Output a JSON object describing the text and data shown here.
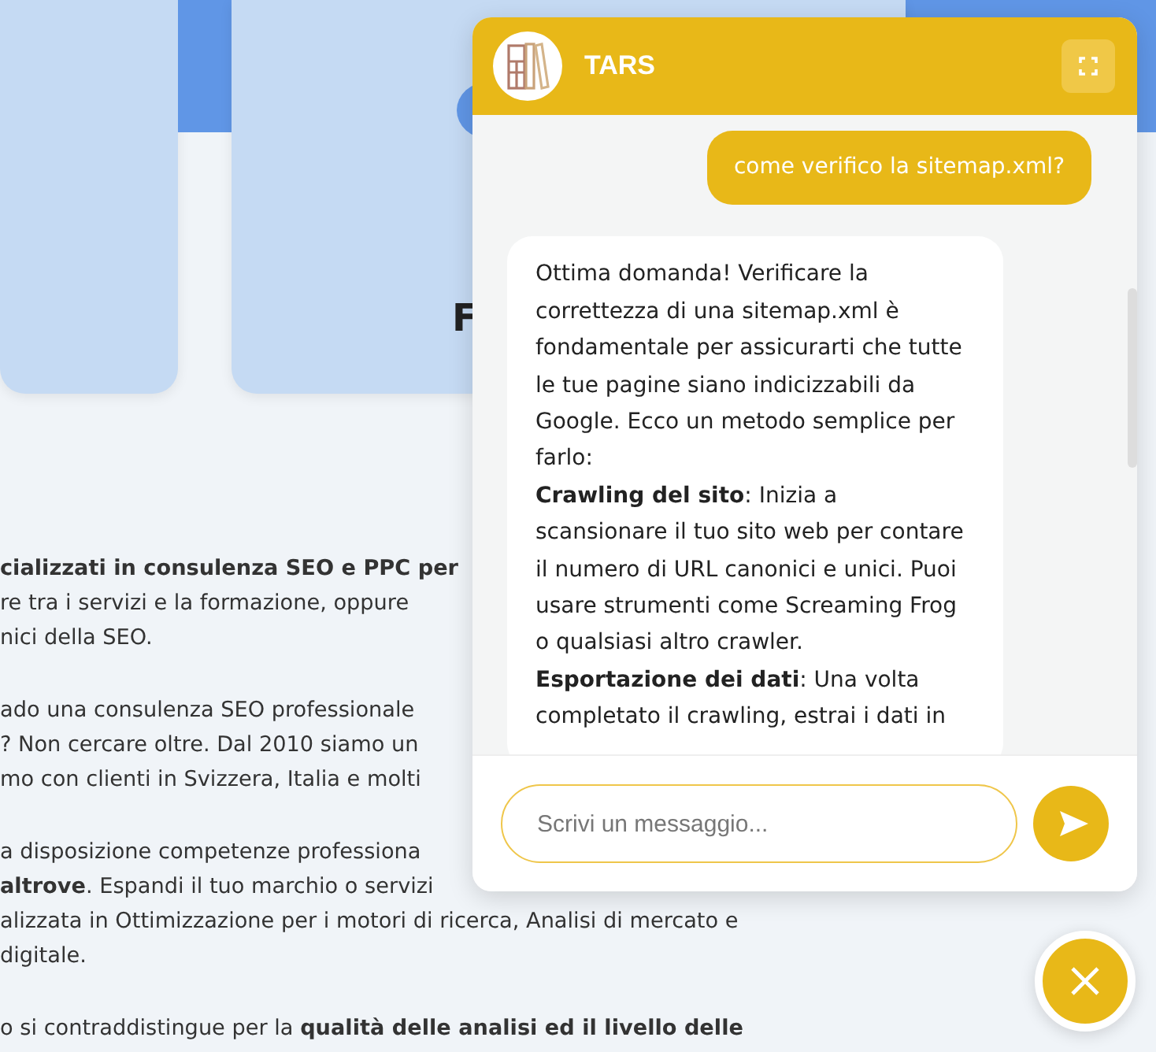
{
  "page": {
    "card_title": "F",
    "paragraphs": [
      [
        "**cializzati in consulenza SEO e PPC per**",
        "re tra i servizi e la formazione, oppure",
        "nici della SEO."
      ],
      [
        "ado una consulenza SEO professionale",
        "? Non cercare oltre. Dal 2010 siamo un",
        "mo con clienti in Svizzera, Italia e molti"
      ],
      [
        "a disposizione competenze professiona",
        "**altrove**. Espandi il tuo marchio o servizi",
        "alizzata in Ottimizzazione per i motori di ricerca, Analisi di mercato e",
        "digitale."
      ],
      [
        "o si contraddistingue per la **qualità delle analisi ed il livello delle**"
      ]
    ]
  },
  "chat": {
    "title": "TARS",
    "messages": [
      {
        "kind": "sent",
        "paragraphs": [
          "come verifico la sitemap.xml?"
        ]
      },
      {
        "kind": "received",
        "paragraphs": [
          "Ottima domanda! Verificare la correttezza di una sitemap.xml è fondamentale per assicurarti che tutte le tue pagine siano indicizzabili da Google. Ecco un metodo semplice per farlo:",
          "**Crawling del sito**: Inizia a scansionare il tuo sito web per contare il numero di URL canonici e unici. Puoi usare strumenti come Screaming Frog o qualsiasi altro crawler.",
          "**Esportazione dei dati**: Una volta completato il crawling, estrai i dati in"
        ]
      }
    ],
    "input": {
      "placeholder": "Scrivi un messaggio..."
    }
  }
}
